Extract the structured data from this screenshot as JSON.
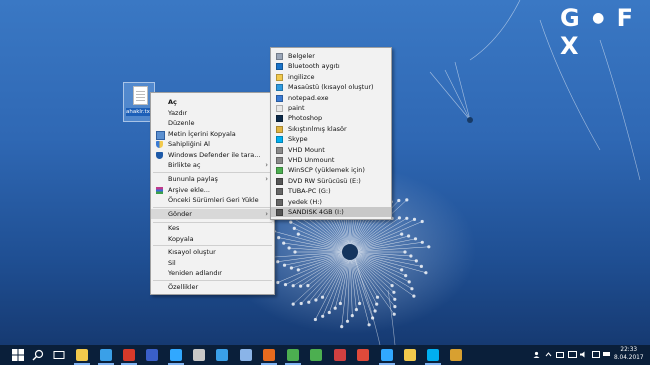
{
  "desktop": {
    "file_label": "ahaklr.txt",
    "logo_letters": [
      "G",
      "F",
      "X"
    ]
  },
  "context_menu": {
    "items": [
      {
        "label": "Aç",
        "bold": true
      },
      {
        "label": "Yazdır"
      },
      {
        "label": "Düzenle"
      },
      {
        "label": "Metin İçerini Kopyala",
        "icon": "copy-icon"
      },
      {
        "label": "Sahipliğini Al",
        "icon": "shield-icon"
      },
      {
        "label": "Windows Defender ile tara...",
        "icon": "defender-icon"
      },
      {
        "label": "Birlikte aç",
        "submenu": true
      },
      {
        "label": "Bununla paylaş",
        "submenu": true
      },
      {
        "label": "Arşive ekle...",
        "icon": "winrar-icon"
      },
      {
        "label": "Önceki Sürümleri Geri Yükle"
      },
      {
        "label": "Gönder",
        "submenu": true,
        "highlighted": true
      },
      {
        "label": "Kes"
      },
      {
        "label": "Kopyala"
      },
      {
        "label": "Kısayol oluştur"
      },
      {
        "label": "Sil"
      },
      {
        "label": "Yeniden adlandır"
      },
      {
        "label": "Özellikler"
      }
    ]
  },
  "send_to_menu": {
    "items": [
      {
        "label": "Belgeler",
        "icon": "documents-icon",
        "color": "#9aa6b8"
      },
      {
        "label": "Bluetooth aygıtı",
        "icon": "bluetooth-icon",
        "color": "#1a73c9"
      },
      {
        "label": "ingilizce",
        "icon": "folder-icon",
        "color": "#f2c94c"
      },
      {
        "label": "Masaüstü (kısayol oluştur)",
        "icon": "desktop-icon",
        "color": "#2f9be0"
      },
      {
        "label": "notepad.exe",
        "icon": "notepad-icon",
        "color": "#3a7bd5"
      },
      {
        "label": "paint",
        "icon": "paint-icon",
        "color": "#e8e8e8"
      },
      {
        "label": "Photoshop",
        "icon": "photoshop-icon",
        "color": "#0b2a4a"
      },
      {
        "label": "Sıkıştırılmış klasör",
        "icon": "zip-folder-icon",
        "color": "#e0b440"
      },
      {
        "label": "Skype",
        "icon": "skype-icon",
        "color": "#00aff0"
      },
      {
        "label": "VHD Mount",
        "icon": "drive-icon",
        "color": "#8a8a8a"
      },
      {
        "label": "VHD Unmount",
        "icon": "drive-icon",
        "color": "#8a8a8a"
      },
      {
        "label": "WinSCP (yüklemek için)",
        "icon": "winscp-icon",
        "color": "#4caf50"
      },
      {
        "label": "DVD RW Sürücüsü (E:)",
        "icon": "dvd-icon",
        "color": "#555555"
      },
      {
        "label": "TUBA-PC (G:)",
        "icon": "drive-icon",
        "color": "#666666"
      },
      {
        "label": "yedek (H:)",
        "icon": "drive-icon",
        "color": "#666666"
      },
      {
        "label": "SANDISK 4GB (I:)",
        "icon": "usb-drive-icon",
        "color": "#555555",
        "highlighted": true
      }
    ]
  },
  "taskbar": {
    "apps": [
      {
        "name": "start-icon",
        "color": "#ffffff"
      },
      {
        "name": "search-icon",
        "color": "#ffffff"
      },
      {
        "name": "task-view-icon",
        "color": "#ffffff"
      },
      {
        "name": "file-explorer-icon",
        "color": "#f2c94c"
      },
      {
        "name": "photos-icon",
        "color": "#3aa0e8"
      },
      {
        "name": "ccleaner-icon",
        "color": "#d83a2a"
      },
      {
        "name": "virtualbox-icon",
        "color": "#3a5fc8"
      },
      {
        "name": "photoshop-icon",
        "color": "#31a8ff"
      },
      {
        "name": "tool-icon",
        "color": "#c8c8c8"
      },
      {
        "name": "network-icon",
        "color": "#3aa0e8"
      },
      {
        "name": "monitor-icon",
        "color": "#8ab4e8"
      },
      {
        "name": "firefox-icon",
        "color": "#e76b1e"
      },
      {
        "name": "chrome-icon",
        "color": "#4caf50"
      },
      {
        "name": "winscp-icon",
        "color": "#4caf50"
      },
      {
        "name": "app-icon",
        "color": "#d04040"
      },
      {
        "name": "chrome-icon-2",
        "color": "#e04a3a"
      },
      {
        "name": "photoshop-icon-2",
        "color": "#31a8ff"
      },
      {
        "name": "folder-icon",
        "color": "#f2c94c"
      },
      {
        "name": "skype-icon",
        "color": "#00aff0"
      },
      {
        "name": "winrar-icon",
        "color": "#d8a030"
      }
    ],
    "clock_time": "22:33",
    "clock_date": "8.04.2017"
  }
}
